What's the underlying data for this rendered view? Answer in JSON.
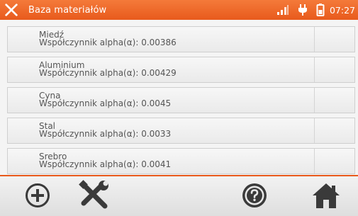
{
  "title_bar": {
    "title": "Baza materiałów",
    "time": "07:27",
    "icons": [
      "tools-icon",
      "signal-icon",
      "power-plug-icon",
      "battery-icon"
    ]
  },
  "materials": [
    {
      "name": "Miedź",
      "coefficient": "Współczynnik alpha(α): 0.00386"
    },
    {
      "name": "Aluminium",
      "coefficient": "Współczynnik alpha(α): 0.00429"
    },
    {
      "name": "Cyna",
      "coefficient": "Współczynnik alpha(α): 0.0045"
    },
    {
      "name": "Stal",
      "coefficient": "Współczynnik alpha(α): 0.0033"
    },
    {
      "name": "Srebro",
      "coefficient": "Współczynnik alpha(α): 0.0041"
    }
  ],
  "toolbar": {
    "buttons": [
      "add-icon",
      "tools-icon",
      "help-icon",
      "home-icon"
    ]
  },
  "colors": {
    "accent": "#e85a1c",
    "icon_dark": "#3a3a3a",
    "text": "#555555"
  }
}
